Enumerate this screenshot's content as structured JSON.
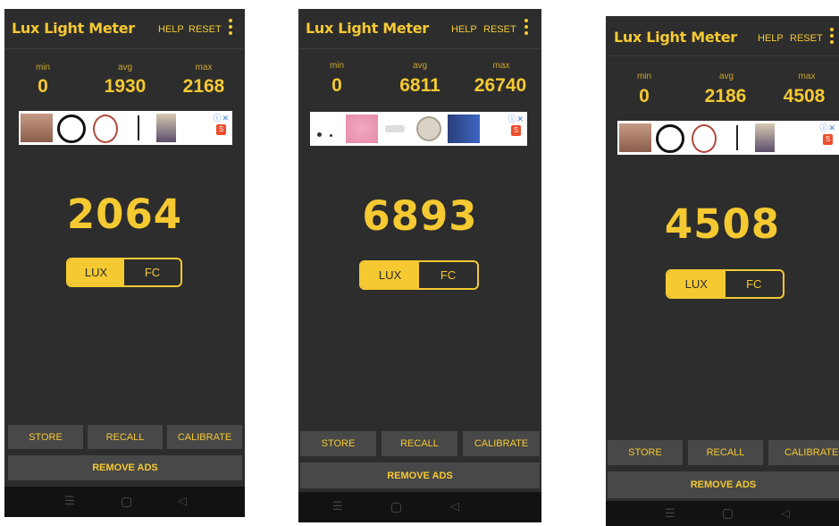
{
  "screens": [
    {
      "app_title": "Lux Light Meter",
      "menu": {
        "help": "HELP",
        "reset": "RESET"
      },
      "stats": {
        "min_label": "min",
        "min": "0",
        "avg_label": "avg",
        "avg": "1930",
        "max_label": "max",
        "max": "2168"
      },
      "reading": "2064",
      "units": {
        "lux": "LUX",
        "fc": "FC",
        "selected": "LUX"
      },
      "buttons": {
        "store": "STORE",
        "recall": "RECALL",
        "calibrate": "CALIBRATE",
        "remove_ads": "REMOVE ADS"
      }
    },
    {
      "app_title": "Lux Light Meter",
      "menu": {
        "help": "HELP",
        "reset": "RESET"
      },
      "stats": {
        "min_label": "min",
        "min": "0",
        "avg_label": "avg",
        "avg": "6811",
        "max_label": "max",
        "max": "26740"
      },
      "reading": "6893",
      "units": {
        "lux": "LUX",
        "fc": "FC",
        "selected": "LUX"
      },
      "buttons": {
        "store": "STORE",
        "recall": "RECALL",
        "calibrate": "CALIBRATE",
        "remove_ads": "REMOVE ADS"
      }
    },
    {
      "app_title": "Lux Light Meter",
      "menu": {
        "help": "HELP",
        "reset": "RESET"
      },
      "stats": {
        "min_label": "min",
        "min": "0",
        "avg_label": "avg",
        "avg": "2186",
        "max_label": "max",
        "max": "4508"
      },
      "reading": "4508",
      "units": {
        "lux": "LUX",
        "fc": "FC",
        "selected": "LUX"
      },
      "buttons": {
        "store": "STORE",
        "recall": "RECALL",
        "calibrate": "CALIBRATE",
        "remove_ads": "REMOVE ADS"
      }
    }
  ],
  "colors": {
    "accent": "#f5c932",
    "background": "#2d2d2d",
    "button": "#484848",
    "nav_bar": "#121212"
  },
  "icons": [
    "overflow-menu-icon",
    "ad-info-icon",
    "ad-close-icon",
    "nav-recents-icon",
    "nav-home-icon",
    "nav-back-icon"
  ]
}
